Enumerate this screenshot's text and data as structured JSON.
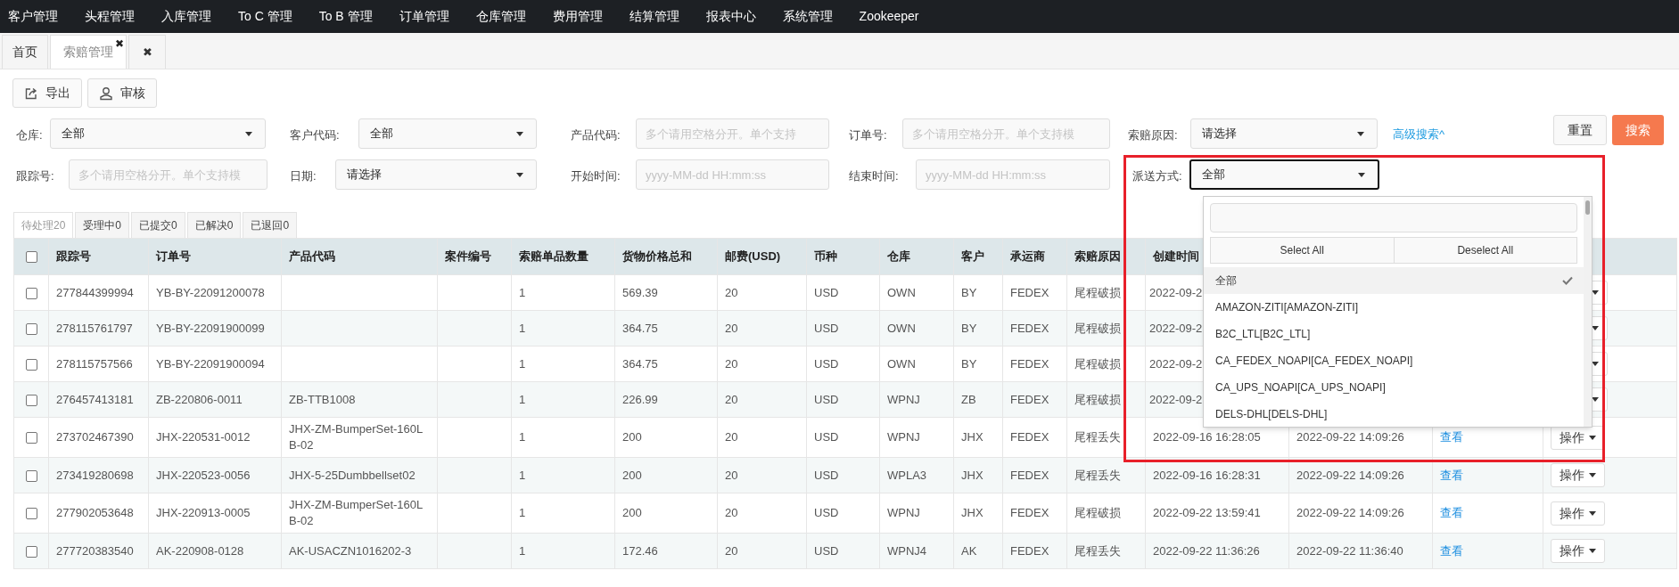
{
  "nav": [
    "客户管理",
    "头程管理",
    "入库管理",
    "To C 管理",
    "To B 管理",
    "订单管理",
    "仓库管理",
    "费用管理",
    "结算管理",
    "报表中心",
    "系统管理",
    "Zookeeper"
  ],
  "tabs": [
    {
      "label": "首页",
      "selected": false
    },
    {
      "label": "索赔管理",
      "selected": true,
      "close": "✖"
    },
    {
      "close": "✖",
      "selected": false
    }
  ],
  "toolbar": [
    {
      "kind": "export",
      "label": "导出"
    },
    {
      "kind": "audit",
      "label": "审核"
    }
  ],
  "filters": [
    [
      {
        "label": "仓库:",
        "kind": "select",
        "value": "全部"
      },
      {
        "label": "客户代码:",
        "kind": "select",
        "value": "全部"
      },
      {
        "label": "产品代码:",
        "kind": "input",
        "placeholder": "多个请用空格分开。单个支持"
      },
      {
        "label": "订单号:",
        "kind": "input",
        "placeholder": "多个请用空格分开。单个支持模"
      },
      {
        "label": "索赔原因:",
        "kind": "select",
        "value": "请选择"
      }
    ],
    [
      {
        "label": "跟踪号:",
        "kind": "input",
        "placeholder": "多个请用空格分开。单个支持模"
      },
      {
        "label": "日期:",
        "kind": "select",
        "value": "请选择"
      },
      {
        "label": "开始时间:",
        "kind": "input",
        "placeholder": "yyyy-MM-dd HH:mm:ss"
      },
      {
        "label": "结束时间:",
        "kind": "input",
        "placeholder": "yyyy-MM-dd HH:mm:ss"
      },
      {
        "label": "派送方式:",
        "kind": "select",
        "value": "全部",
        "focused": true
      }
    ]
  ],
  "advanced_link": "高级搜索^",
  "actions": [
    {
      "kind": "default",
      "label": "重置"
    },
    {
      "kind": "primary",
      "label": "搜索"
    }
  ],
  "status_tabs": [
    {
      "label": "待处理20",
      "selected": true
    },
    {
      "label": "受理中0",
      "selected": false
    },
    {
      "label": "已提交0",
      "selected": false
    },
    {
      "label": "已解决0",
      "selected": false
    },
    {
      "label": "已退回0",
      "selected": false
    }
  ],
  "table": {
    "all_checked": false,
    "columns": [
      "跟踪号",
      "订单号",
      "产品代码",
      "案件编号",
      "索赔单品数量",
      "货物价格总和",
      "邮费(USD)",
      "币种",
      "仓库",
      "客户",
      "承运商",
      "索赔原因",
      "创建时间"
    ],
    "rows": [
      {
        "kind": "covered",
        "checked": false,
        "cells": [
          "277844399994",
          "YB-BY-22091200078",
          "",
          "",
          "1",
          "569.39",
          "20",
          "USD",
          "OWN",
          "BY",
          "FEDEX",
          "尾程破损",
          "2022-09-2"
        ]
      },
      {
        "kind": "covered",
        "checked": false,
        "cells": [
          "278115761797",
          "YB-BY-22091900099",
          "",
          "",
          "1",
          "364.75",
          "20",
          "USD",
          "OWN",
          "BY",
          "FEDEX",
          "尾程破损",
          "2022-09-2"
        ]
      },
      {
        "kind": "covered",
        "checked": false,
        "cells": [
          "278115757566",
          "YB-BY-22091900094",
          "",
          "",
          "1",
          "364.75",
          "20",
          "USD",
          "OWN",
          "BY",
          "FEDEX",
          "尾程破损",
          "2022-09-2"
        ]
      },
      {
        "kind": "covered",
        "checked": false,
        "cells": [
          "276457413181",
          "ZB-220806-0011",
          "ZB-TTB1008",
          "",
          "1",
          "226.99",
          "20",
          "USD",
          "WPNJ",
          "ZB",
          "FEDEX",
          "尾程破损",
          "2022-09-2"
        ]
      },
      {
        "kind": "full",
        "checked": false,
        "cells": [
          "273702467390",
          "JHX-220531-0012",
          "JHX-ZM-BumperSet-160LB-02",
          "",
          "1",
          "200",
          "20",
          "USD",
          "WPNJ",
          "JHX",
          "FEDEX",
          "尾程丢失",
          "2022-09-16 16:28:05",
          "2022-09-22 14:09:26"
        ],
        "view": "查看",
        "action": "操作"
      },
      {
        "kind": "full",
        "checked": false,
        "cells": [
          "273419280698",
          "JHX-220523-0056",
          "JHX-5-25Dumbbellset02",
          "",
          "1",
          "200",
          "20",
          "USD",
          "WPLA3",
          "JHX",
          "FEDEX",
          "尾程丢失",
          "2022-09-16 16:28:31",
          "2022-09-22 14:09:26"
        ],
        "view": "查看",
        "action": "操作"
      },
      {
        "kind": "full",
        "checked": false,
        "cells": [
          "277902053648",
          "JHX-220913-0005",
          "JHX-ZM-BumperSet-160LB-02",
          "",
          "1",
          "200",
          "20",
          "USD",
          "WPNJ",
          "JHX",
          "FEDEX",
          "尾程破损",
          "2022-09-22 13:59:41",
          "2022-09-22 14:09:26"
        ],
        "view": "查看",
        "action": "操作"
      },
      {
        "kind": "full",
        "checked": false,
        "cells": [
          "277720383540",
          "AK-220908-0128",
          "AK-USACZN1016202-3",
          "",
          "1",
          "172.46",
          "20",
          "USD",
          "WPNJ4",
          "AK",
          "FEDEX",
          "尾程丢失",
          "2022-09-22 11:36:26",
          "2022-09-22 11:36:40"
        ],
        "view": "查看",
        "action": "操作"
      }
    ]
  },
  "dropdown": {
    "buttons": [
      "Select All",
      "Deselect All"
    ],
    "options": [
      {
        "label": "全部",
        "selected": true
      },
      {
        "label": "AMAZON-ZITI[AMAZON-ZITI]",
        "selected": false
      },
      {
        "label": "B2C_LTL[B2C_LTL]",
        "selected": false
      },
      {
        "label": "CA_FEDEX_NOAPI[CA_FEDEX_NOAPI]",
        "selected": false
      },
      {
        "label": "CA_UPS_NOAPI[CA_UPS_NOAPI]",
        "selected": false
      },
      {
        "label": "DELS-DHL[DELS-DHL]",
        "selected": false
      }
    ]
  }
}
